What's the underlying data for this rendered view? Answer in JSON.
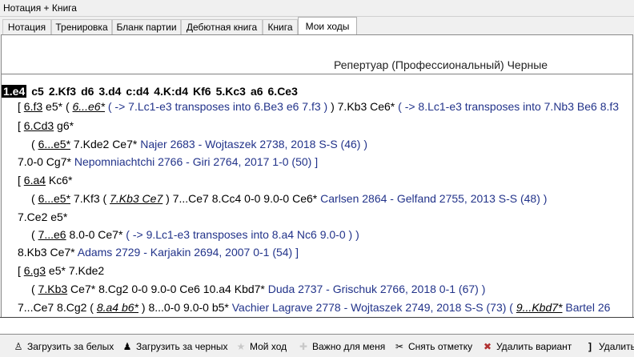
{
  "window": {
    "title": "Нотация + Книга"
  },
  "tabs": [
    "Нотация",
    "Тренировка",
    "Бланк партии",
    "Дебютная книга",
    "Книга",
    "Мои ходы"
  ],
  "header": {
    "repertoire_title": "Репертуар (Профессиональный) Черные"
  },
  "mainline": [
    "1.e4",
    "c5",
    "2.Kf3",
    "d6",
    "3.d4",
    "c:d4",
    "4.K:d4",
    "Kf6",
    "5.Kc3",
    "a6",
    "6.Ce3"
  ],
  "lines": {
    "l1": {
      "a": "[ ",
      "b": "6.f3",
      "c": " e5*  ( ",
      "d": "6...e6*",
      "e": " ( -> 7.Lc1-e3 transposes into 6.Be3 e6 7.f3 ) ",
      "f": ") 7.Kb3  Ce6*",
      "g": " ( -> 8.Lc1-e3 transposes into 7.Nb3 Be6 8.f3"
    },
    "l2": {
      "a": "[ ",
      "b": "6.Cd3",
      "c": "  g6*"
    },
    "l3": {
      "a": "( ",
      "b": "6...e5*",
      "c": " 7.Kde2  Ce7*",
      "d": " Najer 2683 - Wojtaszek 2738, 2018 S-S (46) )"
    },
    "l4": {
      "a": "7.0-0  Cg7*",
      "b": " Nepomniachtchi 2766 - Giri 2764, 2017 1-0 (50) ]"
    },
    "l5": {
      "a": "[ ",
      "b": "6.a4",
      "c": "  Kc6*"
    },
    "l6": {
      "a": "( ",
      "b": "6...e5*",
      "c": " 7.Kf3  ( ",
      "d": "7.Kb3   Ce7",
      "e": " ) 7...Ce7  8.Cc4  0-0  9.0-0  Ce6*",
      "f": " Carlsen 2864 - Gelfand 2755, 2013 S-S (48) )"
    },
    "l7": {
      "a": "7.Ce2  e5*"
    },
    "l8": {
      "a": "( ",
      "b": "7...e6",
      "c": " 8.0-0  Ce7*",
      "d": " ( -> 9.Lc1-e3 transposes into 8.a4 Nc6 9.0-0 ) )"
    },
    "l9": {
      "a": "8.Kb3  Ce7*",
      "b": " Adams 2729 - Karjakin 2694, 2007 0-1 (54) ]"
    },
    "l10": {
      "a": "[ ",
      "b": "6.g3",
      "c": "  e5*  7.Kde2"
    },
    "l11": {
      "a": "( ",
      "b": "7.Kb3",
      "c": "  Ce7*  8.Cg2  0-0  9.0-0  Ce6  10.a4  Kbd7*",
      "d": " Duda 2737 - Grischuk 2766, 2018 0-1 (67) )"
    },
    "l12": {
      "a": "7...Ce7  8.Cg2  ( ",
      "b": "8.a4   b6*",
      "c": " ) 8...0-0  9.0-0  b5*",
      "d": " Vachier Lagrave 2778 - Wojtaszek 2749, 2018 S-S (73)  ( ",
      "e": "9...Kbd7*",
      "f": " Bartel 26"
    }
  },
  "toolbar": {
    "load_white": "Загрузить за белых",
    "load_black": "Загрузить за черных",
    "my_move": "Мой ход",
    "important": "Важно для меня",
    "unmark": "Снять отметку",
    "delete_variant": "Удалить вариант",
    "delete": "Удалить"
  }
}
